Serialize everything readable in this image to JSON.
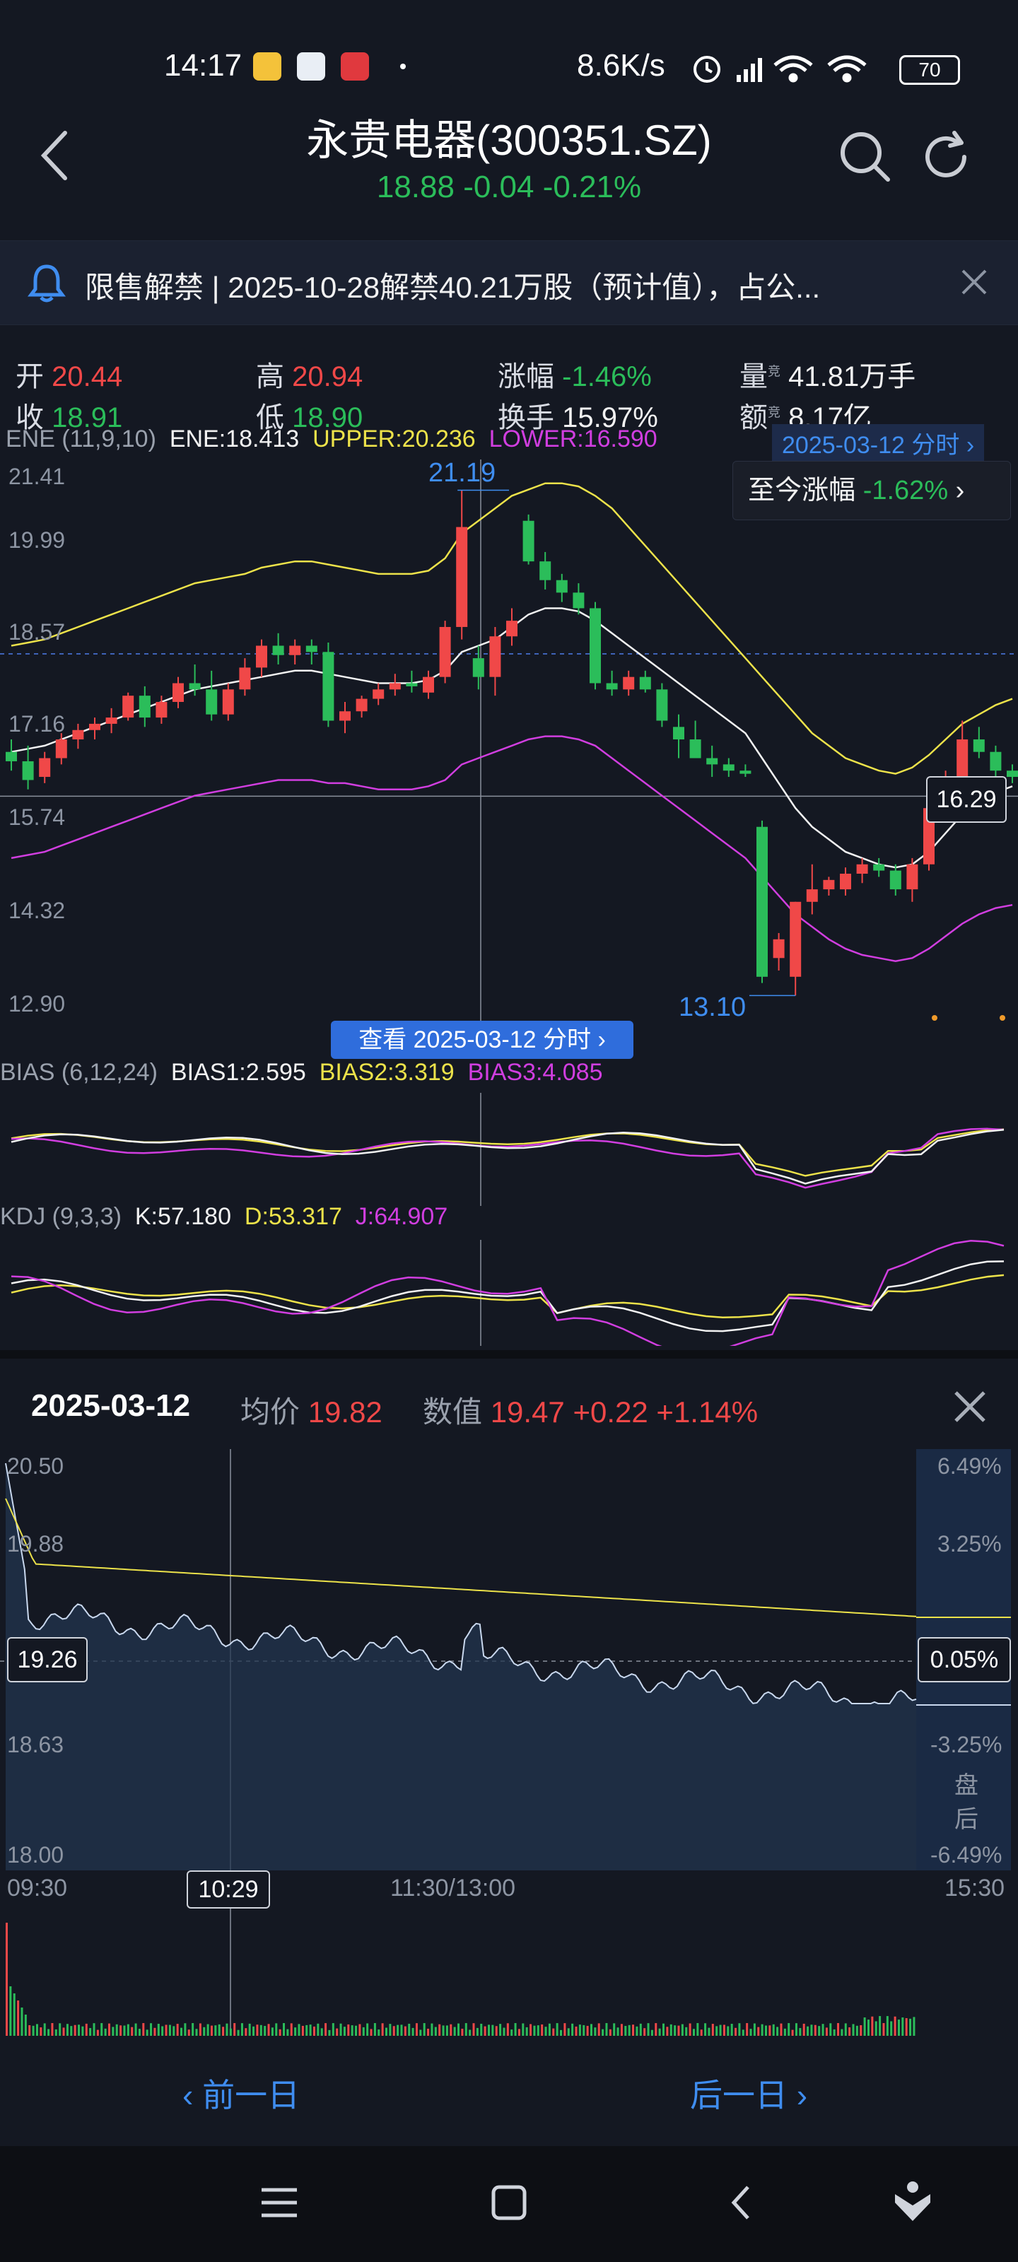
{
  "status_bar": {
    "time": "14:17",
    "net_speed": "8.6K/s",
    "battery": "70"
  },
  "header": {
    "title": "永贵电器(300351.SZ)",
    "price": "18.88",
    "change": "-0.04",
    "change_pct": "-0.21%"
  },
  "notice": {
    "text": "限售解禁 | 2025-10-28解禁40.21万股（预计值），占公..."
  },
  "stats": {
    "open_label": "开",
    "open": "20.44",
    "high_label": "高",
    "high": "20.94",
    "rise_label": "涨幅",
    "rise": "-1.46%",
    "vol_label": "量",
    "vol": "41.81万手",
    "close_label": "收",
    "close": "18.91",
    "low_label": "低",
    "low": "18.90",
    "turnover_label": "换手",
    "turnover": "15.97%",
    "amount_label": "额",
    "amount": "8.17亿",
    "sup": "竞"
  },
  "ene": {
    "name": "ENE (11,9,10)",
    "ene": "ENE:18.413",
    "upper": "UPPER:20.236",
    "lower": "LOWER:16.590"
  },
  "kline": {
    "date_badge": "2025-03-12 分时",
    "to_now_label": "至今涨幅",
    "to_now_value": "-1.62%",
    "y_labels": [
      "21.41",
      "19.99",
      "18.57",
      "17.16",
      "15.74",
      "14.32",
      "12.90"
    ],
    "high_mark": "21.19",
    "low_mark": "13.10",
    "crosshair_value": "16.29",
    "view_button": "查看 2025-03-12 分时"
  },
  "bias": {
    "name": "BIAS (6,12,24)",
    "b1": "BIAS1:2.595",
    "b2": "BIAS2:3.319",
    "b3": "BIAS3:4.085"
  },
  "kdj": {
    "name": "KDJ (9,3,3)",
    "k": "K:57.180",
    "d": "D:53.317",
    "j": "J:64.907"
  },
  "intraday": {
    "date": "2025-03-12",
    "avg_label": "均价",
    "avg_value": "19.82",
    "val_label": "数值",
    "val_value": "19.47",
    "val_change": "+0.22",
    "val_pct": "+1.14%",
    "y_left": [
      "20.50",
      "19.88",
      "19.26",
      "18.63",
      "18.00"
    ],
    "y_right": [
      "6.49%",
      "3.25%",
      "0.05%",
      "-3.25%",
      "-6.49%"
    ],
    "after_hours": "盘后",
    "x_labels": [
      "09:30",
      "10:29",
      "11:30/13:00",
      "15:30"
    ]
  },
  "nav": {
    "prev": "前一日",
    "next": "后一日"
  },
  "chart_data": {
    "type": "candlestick",
    "y_range": [
      12.9,
      21.41
    ],
    "annotations": {
      "high": 21.19,
      "low": 13.1
    },
    "ohlc": [
      [
        17.0,
        17.2,
        16.7,
        16.85
      ],
      [
        16.85,
        17.1,
        16.4,
        16.55
      ],
      [
        16.6,
        17.0,
        16.5,
        16.9
      ],
      [
        16.9,
        17.3,
        16.8,
        17.2
      ],
      [
        17.2,
        17.45,
        17.05,
        17.35
      ],
      [
        17.35,
        17.55,
        17.2,
        17.45
      ],
      [
        17.45,
        17.7,
        17.3,
        17.55
      ],
      [
        17.55,
        17.95,
        17.5,
        17.9
      ],
      [
        17.9,
        18.05,
        17.4,
        17.55
      ],
      [
        17.55,
        17.9,
        17.45,
        17.8
      ],
      [
        17.8,
        18.2,
        17.7,
        18.1
      ],
      [
        18.1,
        18.4,
        17.9,
        18.0
      ],
      [
        18.0,
        18.3,
        17.5,
        17.6
      ],
      [
        17.6,
        18.1,
        17.5,
        18.0
      ],
      [
        18.0,
        18.5,
        17.9,
        18.35
      ],
      [
        18.35,
        18.8,
        18.2,
        18.7
      ],
      [
        18.7,
        18.9,
        18.4,
        18.55
      ],
      [
        18.55,
        18.8,
        18.4,
        18.7
      ],
      [
        18.7,
        18.8,
        18.4,
        18.6
      ],
      [
        18.6,
        18.75,
        17.4,
        17.5
      ],
      [
        17.5,
        17.8,
        17.3,
        17.65
      ],
      [
        17.65,
        17.9,
        17.55,
        17.85
      ],
      [
        17.85,
        18.1,
        17.75,
        18.0
      ],
      [
        18.0,
        18.25,
        17.9,
        18.1
      ],
      [
        18.1,
        18.3,
        17.95,
        18.05
      ],
      [
        17.95,
        18.3,
        17.85,
        18.2
      ],
      [
        18.2,
        19.1,
        18.1,
        19.0
      ],
      [
        19.0,
        21.19,
        18.8,
        20.6
      ],
      [
        18.5,
        18.7,
        18.0,
        18.2
      ],
      [
        18.2,
        19.0,
        17.9,
        18.85
      ],
      [
        18.85,
        19.3,
        18.7,
        19.1
      ],
      [
        20.7,
        20.8,
        20.0,
        20.05
      ],
      [
        20.05,
        20.2,
        19.6,
        19.75
      ],
      [
        19.75,
        19.85,
        19.4,
        19.55
      ],
      [
        19.55,
        19.7,
        19.2,
        19.3
      ],
      [
        19.3,
        19.4,
        18.0,
        18.1
      ],
      [
        18.1,
        18.3,
        17.9,
        18.0
      ],
      [
        18.0,
        18.3,
        17.9,
        18.2
      ],
      [
        18.2,
        18.3,
        17.95,
        18.0
      ],
      [
        18.0,
        18.1,
        17.4,
        17.5
      ],
      [
        17.4,
        17.6,
        16.9,
        17.2
      ],
      [
        17.2,
        17.5,
        17.0,
        16.9
      ],
      [
        16.9,
        17.1,
        16.6,
        16.8
      ],
      [
        16.8,
        16.9,
        16.6,
        16.7
      ],
      [
        16.7,
        16.8,
        16.6,
        16.65
      ],
      [
        15.8,
        15.9,
        13.3,
        13.4
      ],
      [
        13.7,
        14.1,
        13.5,
        14.0
      ],
      [
        13.4,
        14.6,
        13.1,
        14.6
      ],
      [
        14.6,
        15.2,
        14.4,
        14.8
      ],
      [
        14.8,
        15.0,
        14.7,
        14.95
      ],
      [
        14.8,
        15.15,
        14.7,
        15.05
      ],
      [
        15.05,
        15.3,
        14.9,
        15.2
      ],
      [
        15.2,
        15.3,
        15.0,
        15.1
      ],
      [
        15.1,
        15.2,
        14.7,
        14.8
      ],
      [
        14.8,
        15.3,
        14.6,
        15.2
      ],
      [
        15.2,
        16.2,
        15.1,
        16.1
      ],
      [
        16.1,
        16.7,
        16.0,
        16.55
      ],
      [
        16.55,
        17.5,
        16.4,
        17.2
      ],
      [
        17.2,
        17.4,
        16.9,
        17.0
      ],
      [
        17.0,
        17.1,
        16.6,
        16.7
      ],
      [
        16.7,
        16.8,
        16.5,
        16.6
      ]
    ],
    "ene_mid": [
      17.0,
      17.05,
      17.1,
      17.2,
      17.3,
      17.4,
      17.5,
      17.6,
      17.7,
      17.8,
      17.9,
      18.0,
      18.05,
      18.1,
      18.15,
      18.2,
      18.25,
      18.3,
      18.3,
      18.25,
      18.2,
      18.15,
      18.1,
      18.1,
      18.1,
      18.15,
      18.3,
      18.6,
      18.7,
      18.8,
      19.0,
      19.2,
      19.3,
      19.3,
      19.25,
      19.1,
      18.9,
      18.7,
      18.5,
      18.3,
      18.1,
      17.9,
      17.7,
      17.5,
      17.3,
      16.9,
      16.5,
      16.1,
      15.8,
      15.6,
      15.4,
      15.3,
      15.2,
      15.15,
      15.2,
      15.4,
      15.7,
      16.0,
      16.2,
      16.35,
      16.45
    ],
    "ene_upper": [
      18.7,
      18.75,
      18.8,
      18.9,
      19.0,
      19.1,
      19.2,
      19.3,
      19.4,
      19.5,
      19.6,
      19.7,
      19.75,
      19.8,
      19.85,
      19.95,
      20.0,
      20.05,
      20.05,
      20.0,
      19.95,
      19.9,
      19.85,
      19.85,
      19.85,
      19.9,
      20.1,
      20.5,
      20.7,
      20.9,
      21.1,
      21.2,
      21.3,
      21.3,
      21.25,
      21.1,
      20.9,
      20.6,
      20.3,
      20.0,
      19.7,
      19.4,
      19.1,
      18.8,
      18.5,
      18.2,
      17.9,
      17.6,
      17.3,
      17.1,
      16.9,
      16.8,
      16.7,
      16.65,
      16.75,
      16.95,
      17.2,
      17.45,
      17.6,
      17.75,
      17.85
    ],
    "ene_lower": [
      15.3,
      15.35,
      15.4,
      15.5,
      15.6,
      15.7,
      15.8,
      15.9,
      16.0,
      16.1,
      16.2,
      16.3,
      16.35,
      16.4,
      16.45,
      16.5,
      16.55,
      16.55,
      16.55,
      16.5,
      16.5,
      16.45,
      16.4,
      16.4,
      16.4,
      16.45,
      16.55,
      16.8,
      16.9,
      17.0,
      17.1,
      17.2,
      17.25,
      17.25,
      17.2,
      17.1,
      16.9,
      16.7,
      16.5,
      16.3,
      16.1,
      15.9,
      15.7,
      15.5,
      15.3,
      15.0,
      14.7,
      14.4,
      14.2,
      14.0,
      13.85,
      13.75,
      13.7,
      13.65,
      13.7,
      13.85,
      14.05,
      14.25,
      14.4,
      14.5,
      14.55
    ]
  }
}
